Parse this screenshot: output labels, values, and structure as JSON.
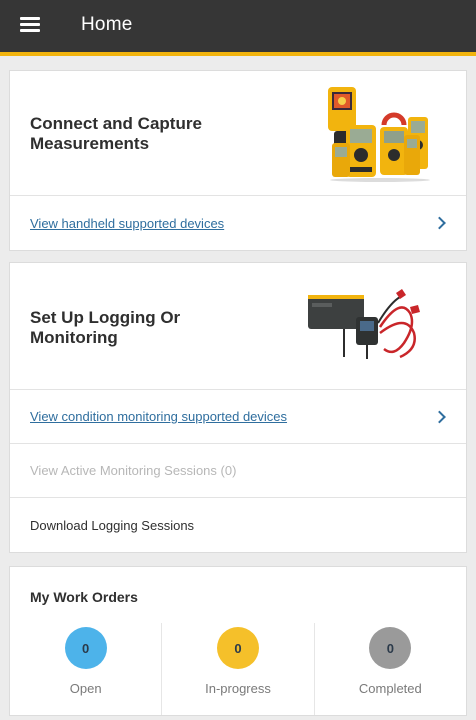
{
  "header": {
    "title": "Home"
  },
  "colors": {
    "accent": "#f2b40e",
    "topbar": "#363636",
    "link": "#2f6e9e"
  },
  "connect_card": {
    "title": "Connect and Capture Measurements",
    "link": "View handheld supported devices"
  },
  "logging_card": {
    "title": "Set Up Logging Or Monitoring",
    "link": "View condition monitoring supported devices",
    "active_sessions": "View Active Monitoring Sessions (0)",
    "download": "Download Logging Sessions"
  },
  "work_orders": {
    "title": "My Work Orders",
    "stats": [
      {
        "count": "0",
        "label": "Open",
        "color": "#4db3ea"
      },
      {
        "count": "0",
        "label": "In-progress",
        "color": "#f5c02a"
      },
      {
        "count": "0",
        "label": "Completed",
        "color": "#9a9a9a"
      }
    ]
  }
}
